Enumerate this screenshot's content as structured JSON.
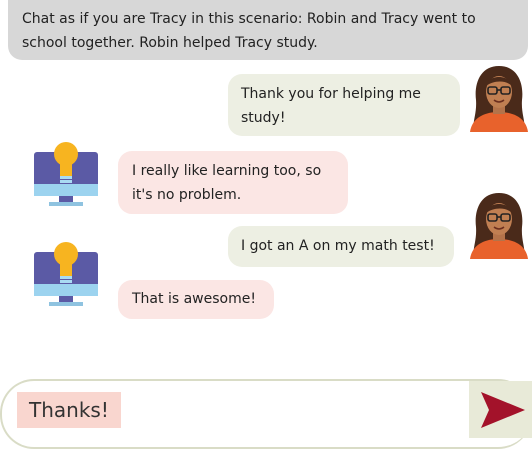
{
  "scenario": {
    "text": "Chat as if you are Tracy in this scenario: Robin and Tracy went to school together. Robin helped Tracy study."
  },
  "messages": [
    {
      "role": "user",
      "text": "Thank you for helping me study!"
    },
    {
      "role": "assistant",
      "text": "I really like learning too, so it's no problem."
    },
    {
      "role": "user",
      "text": "I got an A on my math test!"
    },
    {
      "role": "assistant",
      "text": "That is awesome!"
    }
  ],
  "input": {
    "value": "Thanks!"
  },
  "icons": {
    "user_avatar": "woman-avatar-icon",
    "assistant_avatar": "lightbulb-monitor-icon",
    "send": "send-arrow-icon"
  },
  "colors": {
    "scenario_bg": "#d7d7d7",
    "user_bubble": "#edefe3",
    "bot_bubble": "#fbe6e4",
    "input_highlight": "#f9d6cf",
    "send_arrow": "#a3122a"
  }
}
